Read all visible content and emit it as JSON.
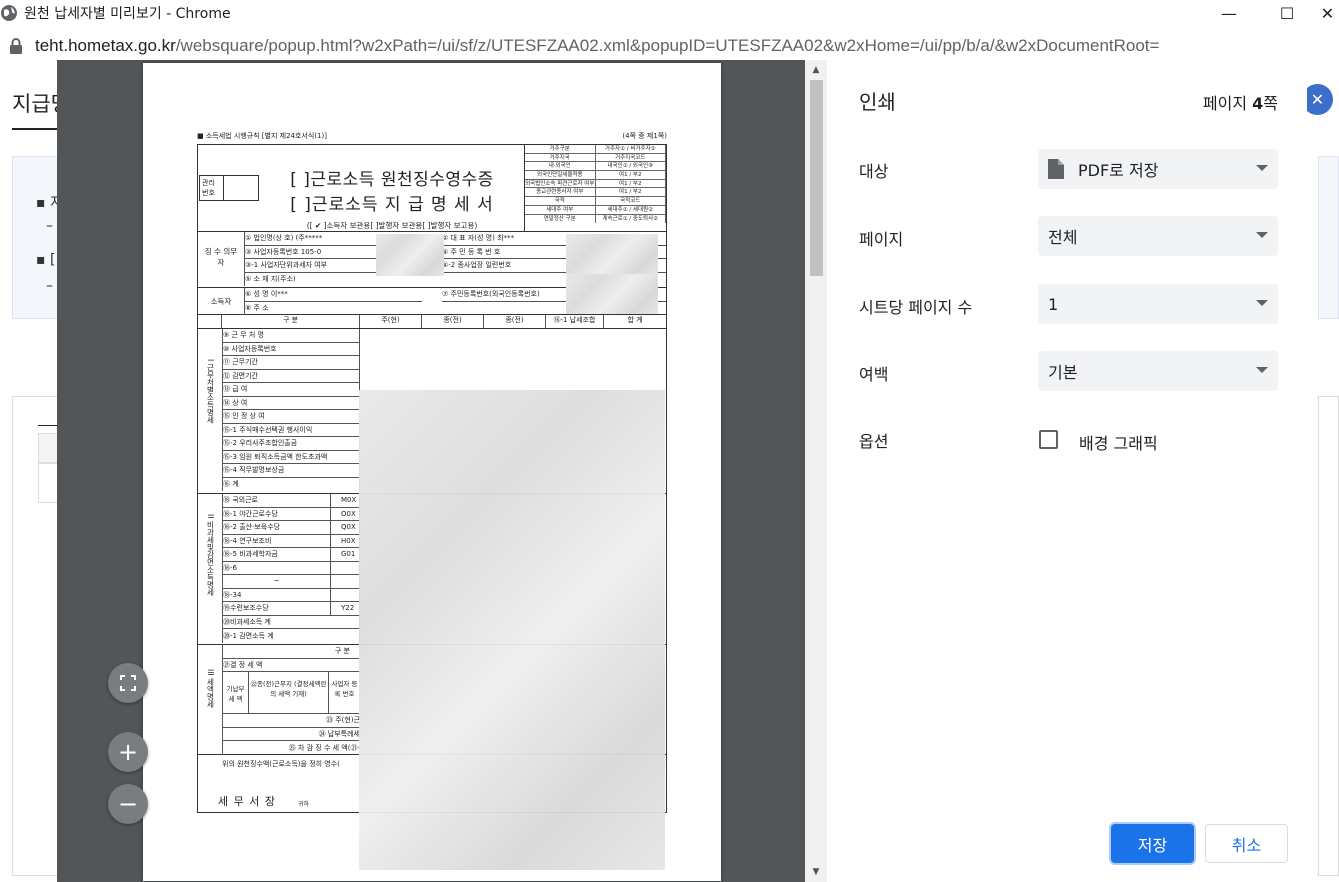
{
  "window": {
    "title": "원천 납세자별 미리보기 - Chrome",
    "minimize": "—",
    "maximize": "☐",
    "close": "✕"
  },
  "address": {
    "host": "teht.hometax.go.kr",
    "rest": "/websquare/popup.html?w2xPath=/ui/sf/z/UTESFZAA02.xml&popupID=UTESFZAA02&w2xHome=/ui/pp/b/a/&w2xDocumentRoot="
  },
  "background_page": {
    "title": "지급명",
    "bullet1": "▪ 지",
    "bullet1_sub": "–",
    "bullet2": "▪ [",
    "bullet2_sub": "–",
    "close_glyph": "✕"
  },
  "form": {
    "top_left": "■ 소득세법 시행규칙 [별지 제24호서식(1)]",
    "top_right": "(4쪽 중 제1쪽)",
    "mgmt_label": "관리번호",
    "title1": "[   ]근로소득 원천징수영수증",
    "title2": "[   ]근로소득 지 급 명 세 서",
    "subtitle": "([ ✔ ]소득자 보관용[      ]발행자 보관용[      ]발행자 보고용)",
    "mini_rows": [
      [
        "거주구분",
        "거주자① / 비거주자②"
      ],
      [
        "거주지국",
        "거주지국코드"
      ],
      [
        "내·외국인",
        "내국인① / 외국인⑨"
      ],
      [
        "외국인단일세율적용",
        "여1 / 부2"
      ],
      [
        "외국법인소속 파견근로자 여부",
        "여1 / 부2"
      ],
      [
        "종교관련종사자 여부",
        "여1 / 부2"
      ],
      [
        "국적",
        "국적코드"
      ],
      [
        "세대주 여부",
        "세대주① / 세대원②"
      ],
      [
        "연말정산 구분",
        "계속근로① / 중도퇴사②"
      ]
    ],
    "payer_label": "징 수 의무자",
    "payer_rows": [
      "① 법인명(상 호)     (주*****",
      "③ 사업자등록번호           105-0",
      "③-1 사업자단위과세자 여부",
      "⑤ 소 재 지(주소)"
    ],
    "payer_right": [
      "② 대 표 자(성   명)          최***",
      "④ 주 민 등 록 번 호",
      "④-2 종사업장 일련번호"
    ],
    "earner_label": "소득자",
    "earner_rows": [
      "⑥ 성       명          이***",
      "⑧ 주       소"
    ],
    "earner_right": "⑦ 주민등록번호(외국인등록번호)",
    "cols": [
      "구   분",
      "주(현)",
      "종(전)",
      "종(전)",
      "⑯-1 납세조합",
      "합   계"
    ],
    "sec1_label": "I 근무처별소득명세",
    "sec1_rows": [
      "⑨ 근 무 처 명",
      "⑩ 사업자등록번호",
      "⑪ 근무기간",
      "⑫ 감면기간",
      "⑬ 급       여",
      "⑭ 상       여",
      "⑮ 인 정 상 여",
      "⑮-1 주식매수선택권 행사이익",
      "⑮-2 우리사주조합인출금",
      "⑮-3 임원 퇴직소득금액 한도초과액",
      "⑮-4 직무발명보상금",
      "⑯ 계"
    ],
    "sec2_label": "II 비과세및감면소득명세",
    "sec2_rows": [
      [
        "⑱ 국외근로",
        "M0X"
      ],
      [
        "⑱-1 야간근로수당",
        "O0X"
      ],
      [
        "⑱-2 출산·보육수당",
        "Q0X"
      ],
      [
        "⑱-4 연구보조비",
        "H0X"
      ],
      [
        "⑱-5 비과세학자금",
        "G01"
      ],
      [
        "⑱-6",
        ""
      ],
      [
        "~",
        ""
      ],
      [
        "⑱-34",
        ""
      ],
      [
        "⑲수련보조수당",
        "Y22"
      ],
      [
        "⑳비과세소득 계",
        ""
      ],
      [
        "⑳-1 감면소득 계",
        ""
      ]
    ],
    "sec3_label": "III 세액명세",
    "sec3_header": "구   분",
    "sec3_rows": [
      "㉑결  정  세  액",
      "기납부 세 액",
      "㉒종(전)근무지 (결정세액란의 세액 기재)",
      "사업자 등록 번호",
      "㉓ 주(현)근",
      "㉔ 납부특례세",
      "㉕ 차 감 징 수 세 액(㉑-"
    ],
    "footer": "위의 원천징수액(근로소득)을 정히 영수(",
    "sign": "세 무 서 장",
    "sign_suffix": "귀하"
  },
  "zoom": {
    "fit_icon": "⛶",
    "zoom_in": "+",
    "zoom_out": "−"
  },
  "print": {
    "title": "인쇄",
    "page_count_prefix": "페이지 ",
    "page_count_num": "4",
    "page_count_suffix": "쪽",
    "destination_label": "대상",
    "destination_value": "PDF로 저장",
    "pages_label": "페이지",
    "pages_value": "전체",
    "per_sheet_label": "시트당 페이지 수",
    "per_sheet_value": "1",
    "margins_label": "여백",
    "margins_value": "기본",
    "options_label": "옵션",
    "background_graphics": "배경 그래픽",
    "background_graphics_checked": false,
    "save": "저장",
    "cancel": "취소",
    "accent": "#1a73e8"
  }
}
